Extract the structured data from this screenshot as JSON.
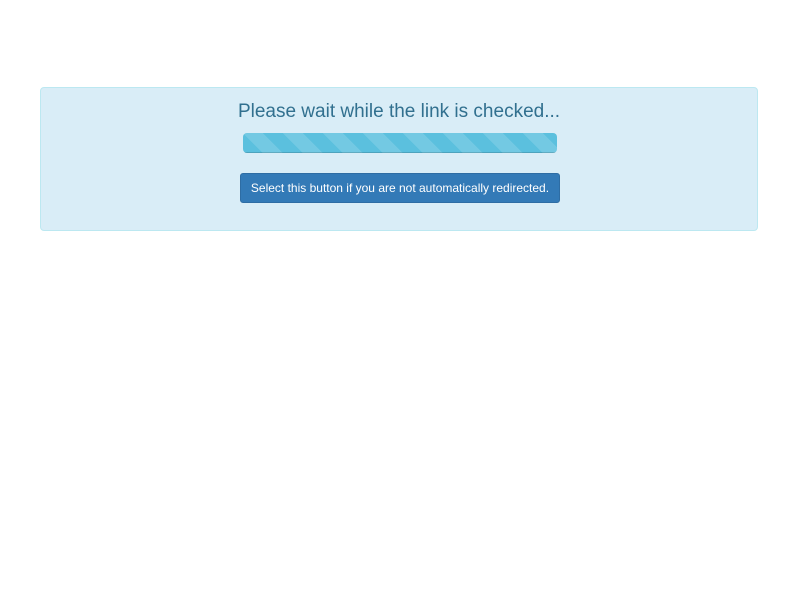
{
  "alert": {
    "message": "Please wait while the link is checked...",
    "progress_percent": 100,
    "button_label": "Select this button if you are not automatically redirected."
  },
  "colors": {
    "panel_background": "#d9edf7",
    "panel_border": "#bce8f1",
    "message_text": "#31708f",
    "progress_fill": "#5bc0de",
    "button_background": "#337ab7"
  }
}
